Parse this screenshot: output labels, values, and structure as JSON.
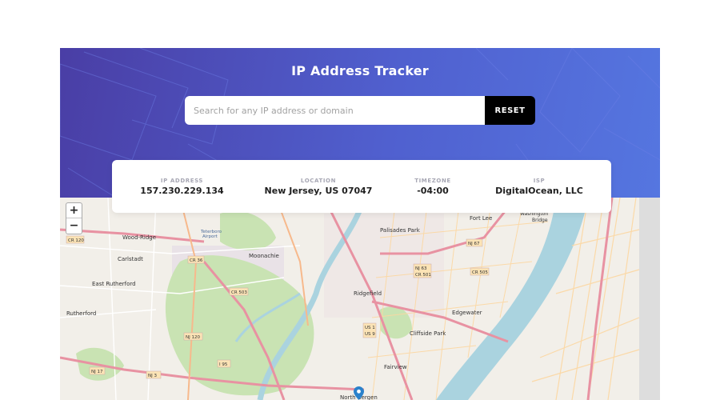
{
  "header": {
    "title": "IP Address Tracker"
  },
  "search": {
    "placeholder": "Search for any IP address or domain",
    "value": "",
    "button_label": "RESET"
  },
  "info": [
    {
      "label": "IP ADDRESS",
      "value": "157.230.229.134"
    },
    {
      "label": "LOCATION",
      "value": "New Jersey, US 07047"
    },
    {
      "label": "TIMEZONE",
      "value": "-04:00"
    },
    {
      "label": "ISP",
      "value": "DigitalOcean, LLC"
    }
  ],
  "map": {
    "zoom_in_label": "+",
    "zoom_out_label": "−",
    "place_labels": [
      "Fort Lee",
      "Washington Bridge",
      "Wood-Ridge",
      "Teterboro Airport",
      "Palisades Park",
      "Carlstadt",
      "Moonachie",
      "Ridgefield",
      "East Rutherford",
      "Rutherford",
      "Edgewater",
      "Cliffside Park",
      "Fairview",
      "North Bergen"
    ],
    "road_shields": [
      "CR 120",
      "CR 36",
      "CR 503",
      "NJ 120",
      "NJ 17",
      "NJ 3",
      "I 95",
      "US 1",
      "US 9",
      "NJ 63",
      "CR 501",
      "CR 505",
      "NJ 67"
    ],
    "colors": {
      "land": "#f2efe9",
      "water": "#aad3df",
      "park": "#c9e3b3",
      "road_major": "#e892a2",
      "road_minor": "#fcd7a1",
      "pin": "#2a81cb"
    }
  }
}
